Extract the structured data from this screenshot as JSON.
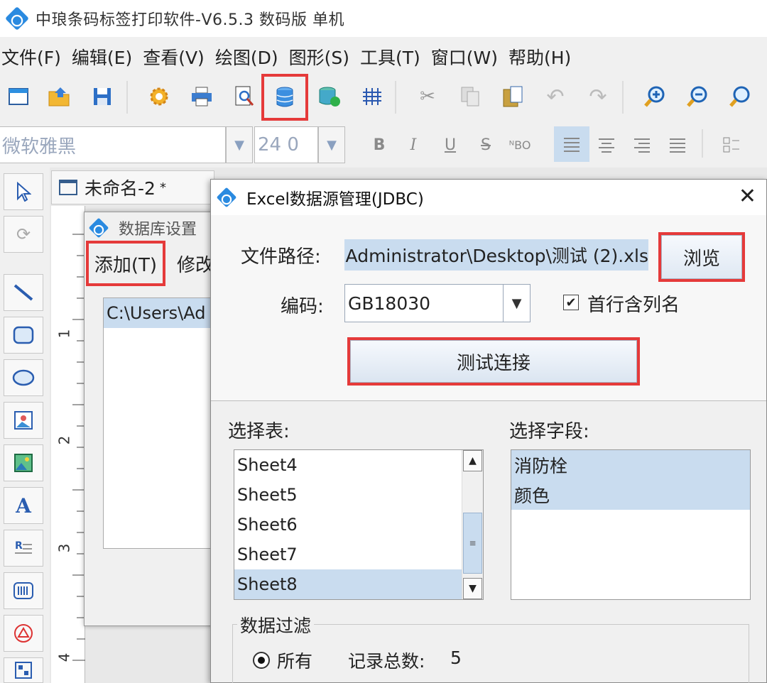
{
  "app": {
    "title": "中琅条码标签打印软件-V6.5.3 数码版 单机"
  },
  "menu": [
    "文件(F)",
    "编辑(E)",
    "查看(V)",
    "绘图(D)",
    "图形(S)",
    "工具(T)",
    "窗口(W)",
    "帮助(H)"
  ],
  "toolbar": {
    "icons": [
      "new-window-icon",
      "open-folder-icon",
      "save-icon",
      "settings-gear-icon",
      "print-icon",
      "print-preview-icon",
      "database-icon",
      "database-connect-icon",
      "grid-icon",
      "cut-icon",
      "copy-icon",
      "paste-icon",
      "undo-icon",
      "redo-icon",
      "zoom-in-icon",
      "zoom-out-icon",
      "zoom-icon"
    ],
    "highlighted": "database-icon"
  },
  "format_bar": {
    "font": "微软雅黑",
    "size": "24 0",
    "bold": "B",
    "italic": "I",
    "underline": "U",
    "strike": "S",
    "special": "ᴺBO"
  },
  "document": {
    "tab_label": "未命名-2",
    "tab_modified": "*"
  },
  "ruler": {
    "marks": [
      "1",
      "2",
      "3",
      "4"
    ]
  },
  "db_dialog": {
    "title": "数据库设置",
    "add_label": "添加(T)",
    "modify_label": "修改",
    "list_item": "C:\\Users\\Ad"
  },
  "excel_dialog": {
    "title": "Excel数据源管理(JDBC)",
    "close": "✕",
    "path_label": "文件路径:",
    "path_value": "Administrator\\Desktop\\测试 (2).xls",
    "browse_label": "浏览",
    "encoding_label": "编码:",
    "encoding_value": "GB18030",
    "header_checkbox_label": "首行含列名",
    "header_checked": true,
    "test_label": "测试连接",
    "table_label": "选择表:",
    "tables": [
      "Sheet4",
      "Sheet5",
      "Sheet6",
      "Sheet7",
      "Sheet8"
    ],
    "selected_table": "Sheet8",
    "field_label": "选择字段:",
    "fields": [
      "消防栓",
      "颜色"
    ],
    "filter_label": "数据过滤",
    "filter_all_label": "所有",
    "total_label": "记录总数:",
    "total_value": "5"
  },
  "colors": {
    "highlight": "#e53a3a",
    "selection": "#c9dcef",
    "brand": "#2a8ae0"
  }
}
